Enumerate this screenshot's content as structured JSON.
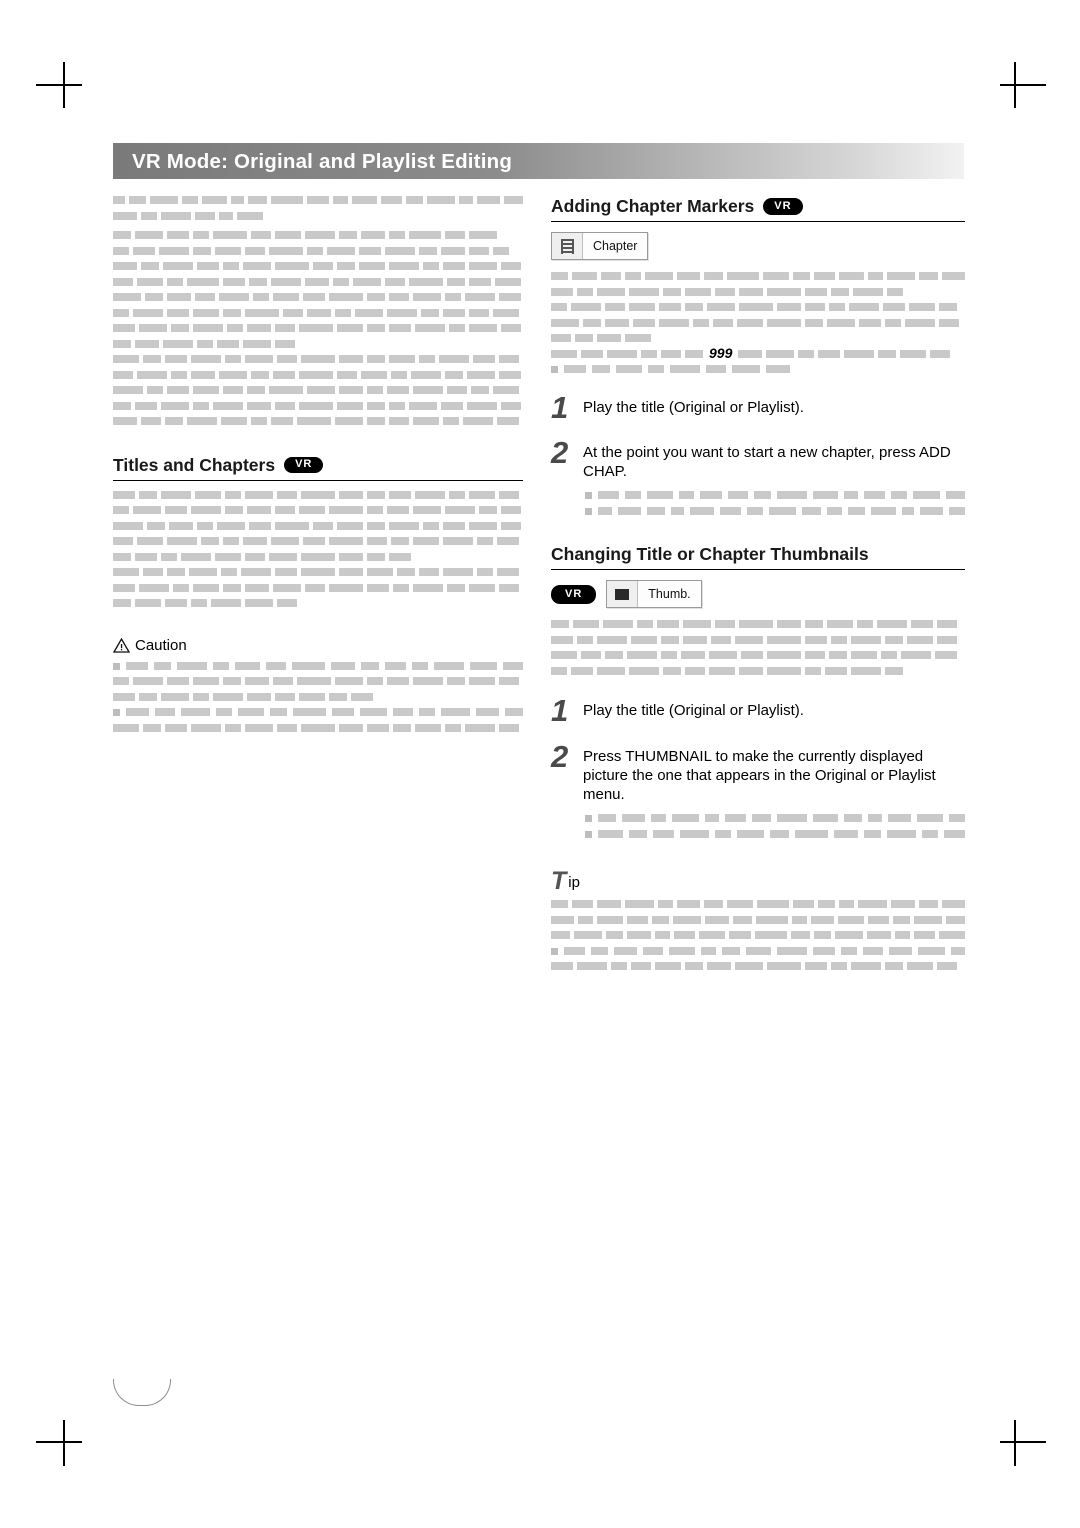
{
  "page": {
    "header_title": "VR Mode: Original and Playlist Editing",
    "page_number": ""
  },
  "left_column": {
    "intro_greeked": true,
    "section_titles": {
      "titles_and_chapters": "Titles and Chapters",
      "titles_and_chapters_badge": "VR"
    },
    "caution": {
      "label": "Caution",
      "icon": "warning-triangle-icon"
    }
  },
  "right_column": {
    "adding_chapter_markers": {
      "title": "Adding Chapter Markers",
      "badge": "VR",
      "chip": {
        "icon": "film-strip-icon",
        "label": "Chapter"
      },
      "inline_mark": "999",
      "steps": [
        {
          "num": "1",
          "text": "Play the title (Original or Playlist)."
        },
        {
          "num": "2",
          "text": "At the point you want to start a new chapter, press ADD CHAP."
        }
      ]
    },
    "changing_thumbnails": {
      "title": "Changing Title or Chapter Thumbnails",
      "badge": "VR",
      "chip": {
        "icon": "thumbnail-icon",
        "label": "Thumb."
      },
      "steps": [
        {
          "num": "1",
          "text": "Play the title (Original or Playlist)."
        },
        {
          "num": "2",
          "text": "Press THUMBNAIL to make the currently displayed picture the one that appears in the Original or Playlist menu."
        }
      ]
    },
    "tip": {
      "label": "ip",
      "lead_letter": "T"
    }
  },
  "greek_blocks": {
    "left_intro_a": [
      [
        14,
        20,
        34,
        18,
        30,
        16,
        22,
        38,
        26,
        18,
        30,
        24,
        20,
        34,
        16,
        28,
        22
      ],
      [
        24,
        16,
        30,
        20,
        14,
        26
      ]
    ],
    "left_intro_b": [
      [
        18,
        28,
        22,
        16,
        34,
        20,
        26,
        30,
        18,
        24,
        16,
        32,
        20,
        28
      ],
      [
        16,
        22,
        30,
        18,
        26,
        20,
        34,
        16,
        28,
        22,
        30,
        18,
        24,
        20,
        16
      ],
      [
        24,
        18,
        30,
        22,
        16,
        28,
        34,
        20,
        18,
        26,
        30,
        16,
        22,
        28,
        20
      ],
      [
        20,
        26,
        16,
        32,
        22,
        18,
        30,
        24,
        16,
        28,
        20,
        34,
        18,
        22,
        26
      ],
      [
        28,
        18,
        24,
        20,
        30,
        16,
        26,
        22,
        34,
        18,
        20,
        28,
        16,
        30,
        22
      ],
      [
        16,
        30,
        22,
        26,
        18,
        34,
        20,
        24,
        16,
        28,
        30,
        18,
        22,
        20,
        26
      ],
      [
        22,
        28,
        18,
        30,
        16,
        24,
        20,
        34,
        26,
        18,
        22,
        30,
        16,
        28,
        20
      ],
      [
        18,
        24,
        30,
        16,
        22,
        28,
        20
      ],
      [
        26,
        18,
        22,
        30,
        16,
        28,
        20,
        34,
        24,
        18,
        26,
        16,
        30,
        22,
        20
      ],
      [
        20,
        30,
        16,
        24,
        28,
        18,
        22,
        34,
        20,
        26,
        16,
        30,
        18,
        28,
        22
      ],
      [
        30,
        16,
        22,
        26,
        20,
        18,
        34,
        28,
        24,
        16,
        22,
        30,
        20,
        18,
        26
      ],
      [
        18,
        22,
        28,
        16,
        30,
        24,
        20,
        34,
        26,
        18,
        16,
        28,
        22,
        30,
        20
      ],
      [
        24,
        20,
        18,
        30,
        26,
        16,
        22,
        34,
        28,
        18,
        20,
        26,
        16,
        30,
        22
      ]
    ],
    "left_titles": [
      [
        22,
        18,
        30,
        26,
        16,
        28,
        20,
        34,
        24,
        18,
        22,
        30,
        16,
        26,
        20
      ],
      [
        16,
        28,
        22,
        30,
        18,
        24,
        20,
        26,
        34,
        16,
        22,
        28,
        30,
        18,
        20
      ],
      [
        30,
        18,
        24,
        16,
        28,
        22,
        34,
        20,
        26,
        18,
        30,
        16,
        22,
        28,
        20
      ],
      [
        20,
        26,
        30,
        18,
        16,
        24,
        28,
        22,
        34,
        20,
        18,
        26,
        30,
        16,
        22
      ],
      [
        18,
        22,
        16,
        30,
        26,
        20,
        28,
        34,
        24,
        18,
        22
      ],
      [
        26,
        20,
        18,
        28,
        16,
        30,
        22,
        34,
        24,
        26,
        18,
        20,
        30,
        16,
        22
      ],
      [
        22,
        30,
        16,
        26,
        18,
        24,
        28,
        20,
        34,
        22,
        16,
        30,
        18,
        26,
        20
      ],
      [
        18,
        26,
        22,
        16,
        30,
        28,
        20
      ]
    ],
    "left_caution": [
      [
        10,
        22,
        18,
        30,
        16,
        26,
        20,
        34,
        24,
        18,
        22,
        16,
        30,
        28,
        20
      ],
      [
        16,
        30,
        22,
        26,
        18,
        24,
        20,
        34,
        28,
        16,
        22,
        30,
        18,
        26,
        20
      ],
      [
        22,
        18,
        28,
        16,
        30,
        24,
        20,
        26,
        18,
        22
      ],
      [
        10,
        24,
        20,
        30,
        16,
        26,
        18,
        34,
        22,
        28,
        20,
        16,
        30,
        24,
        18
      ],
      [
        26,
        18,
        22,
        30,
        16,
        28,
        20,
        34,
        24,
        22,
        18,
        26,
        16,
        30,
        20
      ]
    ],
    "right_chapter": [
      [
        18,
        26,
        22,
        16,
        30,
        24,
        20,
        34,
        28,
        18,
        22,
        26,
        16,
        30,
        20,
        24
      ],
      [
        22,
        16,
        28,
        30,
        18,
        26,
        20,
        24,
        34,
        22,
        18,
        30,
        16
      ],
      [
        16,
        30,
        20,
        26,
        22,
        18,
        28,
        34,
        24,
        20,
        16,
        30,
        22,
        26,
        18
      ],
      [
        28,
        18,
        24,
        22,
        30,
        16,
        20,
        26,
        34,
        18,
        28,
        22,
        16,
        30,
        20
      ],
      [
        20,
        18,
        24,
        26
      ],
      [
        26,
        22,
        30,
        16,
        20,
        18,
        "999",
        24,
        28,
        16,
        22,
        30,
        18,
        26,
        20
      ],
      [
        10,
        22,
        18,
        26,
        16,
        30,
        20,
        28,
        24
      ]
    ],
    "right_step2_sub": [
      [
        10,
        24,
        18,
        30,
        16,
        26,
        22,
        20,
        34,
        28,
        16,
        24,
        18,
        30,
        22
      ],
      [
        10,
        18,
        28,
        22,
        16,
        30,
        26,
        20,
        34,
        24,
        18,
        22,
        30,
        16,
        28,
        20
      ]
    ],
    "right_thumb": [
      [
        18,
        26,
        30,
        16,
        22,
        28,
        20,
        34,
        24,
        18,
        26,
        16,
        30,
        22,
        20
      ],
      [
        22,
        16,
        30,
        26,
        18,
        24,
        20,
        28,
        34,
        22,
        16,
        30,
        18,
        26,
        20
      ],
      [
        26,
        20,
        18,
        30,
        16,
        24,
        28,
        22,
        34,
        20,
        18,
        26,
        16,
        30,
        22
      ],
      [
        16,
        22,
        28,
        30,
        18,
        20,
        26,
        24,
        34,
        16,
        22,
        30,
        18
      ]
    ],
    "right_thumb_sub": [
      [
        10,
        20,
        26,
        18,
        30,
        16,
        24,
        22,
        34,
        28,
        20,
        16,
        26,
        30,
        18
      ],
      [
        10,
        26,
        18,
        22,
        30,
        16,
        28,
        20,
        34,
        24,
        18,
        30,
        16,
        22
      ]
    ],
    "right_tip": [
      [
        18,
        22,
        26,
        30,
        16,
        24,
        20,
        28,
        34,
        22,
        18,
        16,
        30,
        26,
        20,
        24
      ],
      [
        24,
        16,
        28,
        22,
        18,
        30,
        26,
        20,
        34,
        16,
        24,
        28,
        22,
        18,
        30,
        20
      ],
      [
        20,
        30,
        18,
        26,
        16,
        22,
        28,
        24,
        34,
        20,
        18,
        30,
        26,
        16,
        22,
        28
      ],
      [
        10,
        24,
        18,
        26,
        22,
        30,
        16,
        20,
        28,
        34,
        24,
        18,
        22,
        26,
        30,
        16
      ],
      [
        22,
        30,
        16,
        20,
        26,
        18,
        24,
        28,
        34,
        22,
        16,
        30,
        18,
        26,
        20
      ]
    ]
  }
}
